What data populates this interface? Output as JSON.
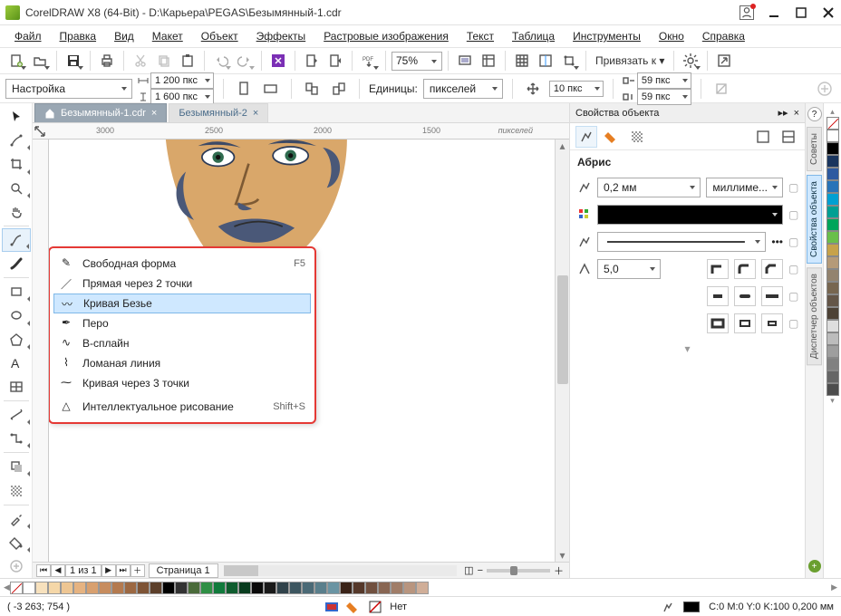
{
  "title": "CorelDRAW X8 (64-Bit) - D:\\Карьера\\PEGAS\\Безымянный-1.cdr",
  "menu": [
    "Файл",
    "Правка",
    "Вид",
    "Макет",
    "Объект",
    "Эффекты",
    "Растровые изображения",
    "Текст",
    "Таблица",
    "Инструменты",
    "Окно",
    "Справка"
  ],
  "toolbar": {
    "zoom": "75%",
    "bind": "Привязать к"
  },
  "propbar": {
    "preset": "Настройка",
    "width": "1 200 пкс",
    "height": "1 600 пкс",
    "units_label": "Единицы:",
    "units_value": "пикселей",
    "nudge": "10 пкс",
    "dx": "59 пкс",
    "dy": "59 пкс"
  },
  "tabs": {
    "active": "Безымянный-1.cdr",
    "other": "Безымянный-2"
  },
  "ruler": {
    "ticks": [
      "3000",
      "2500",
      "2000",
      "1500"
    ],
    "unit": "пикселей"
  },
  "flyout": {
    "items": [
      {
        "label": "Свободная форма",
        "shortcut": "F5"
      },
      {
        "label": "Прямая через 2 точки",
        "shortcut": ""
      },
      {
        "label": "Кривая Безье",
        "shortcut": ""
      },
      {
        "label": "Перо",
        "shortcut": ""
      },
      {
        "label": "В-сплайн",
        "shortcut": ""
      },
      {
        "label": "Ломаная линия",
        "shortcut": ""
      },
      {
        "label": "Кривая через 3 точки",
        "shortcut": ""
      },
      {
        "label": "Интеллектуальное рисование",
        "shortcut": "Shift+S"
      }
    ],
    "selected": 2
  },
  "pages": {
    "current": "1",
    "label": "из",
    "total": "1",
    "page_tab": "Страница 1"
  },
  "docker": {
    "title": "Свойства объекта",
    "section": "Абрис",
    "stroke": "0,2 мм",
    "units": "миллиме...",
    "miter": "5,0"
  },
  "vtabs": [
    "Советы",
    "Свойства объекта",
    "Диспетчер объектов"
  ],
  "status": {
    "coords": "( -3 263; 754   )",
    "none": "Нет",
    "color": "C:0 M:0 Y:0 K:100  0,200 мм"
  },
  "palette": [
    "#ffffff",
    "#000000",
    "#1a355e",
    "#2e5aa0",
    "#2873b8",
    "#00a0d2",
    "#009f93",
    "#00a55a",
    "#6abf4b",
    "#c7a24a",
    "#b59a78",
    "#93836e",
    "#776650",
    "#645648",
    "#4d4236",
    "#dedede",
    "#bcbcbc",
    "#9e9e9e",
    "#818181",
    "#666666",
    "#4d4d4d"
  ],
  "hpalette": [
    "#ffffff",
    "#f7e1bd",
    "#f5d7a8",
    "#eec693",
    "#e6b381",
    "#d8a06f",
    "#c78c5e",
    "#b47a4f",
    "#9c6842",
    "#7e5436",
    "#5c3f2a",
    "#000000",
    "#333333",
    "#4a6b3a",
    "#2f8f45",
    "#117a3c",
    "#0f5c2e",
    "#083c1e",
    "#0a0a0a",
    "#1a1a1a",
    "#30424a",
    "#3d5660",
    "#4b6a76",
    "#5a7f8c",
    "#6a94a3",
    "#3a2318",
    "#55382a",
    "#70503f",
    "#886653",
    "#a07d68",
    "#b8957f",
    "#d0ae98"
  ]
}
